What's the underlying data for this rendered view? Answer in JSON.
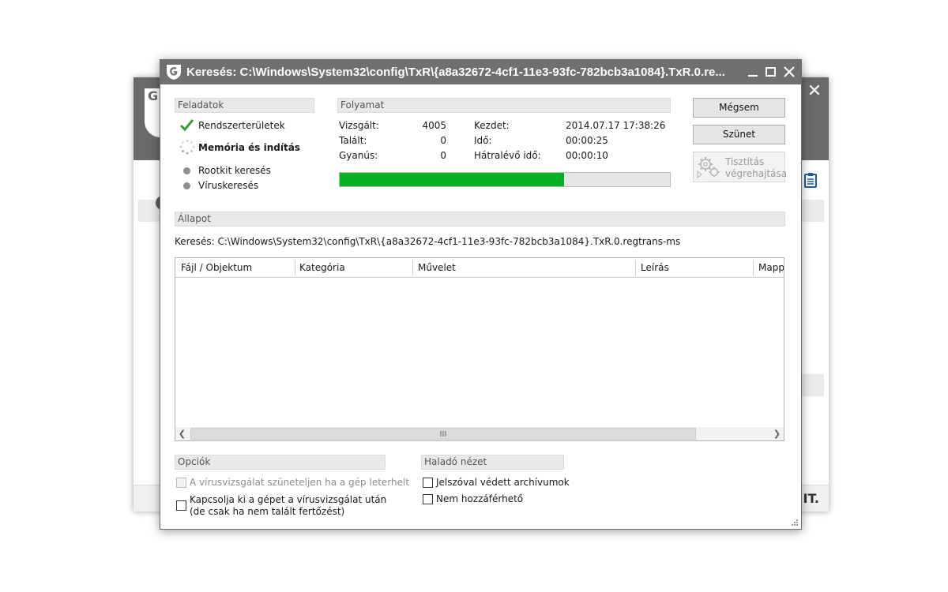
{
  "window": {
    "title": "Keresés: C:\\Windows\\System32\\config\\TxR\\{a8a32672-4cf1-11e3-93fc-782bcb3a1084}.TxR.0.re..."
  },
  "background_window": {
    "logo_text": "G",
    "footer_text": "IT."
  },
  "tasks": {
    "header": "Feladatok",
    "items": [
      {
        "label": "Rendszerterületek",
        "state": "done"
      },
      {
        "label": "Memória és indítás",
        "state": "running"
      },
      {
        "label": "Rootkit keresés",
        "state": "pending"
      },
      {
        "label": "Víruskeresés",
        "state": "pending"
      }
    ]
  },
  "progress": {
    "header": "Folyamat",
    "scanned_label": "Vizsgált:",
    "scanned_value": "4005",
    "found_label": "Talált:",
    "found_value": "0",
    "suspicious_label": "Gyanús:",
    "suspicious_value": "0",
    "start_label": "Kezdet:",
    "start_value": "2014.07.17 17:38:26",
    "time_label": "Idő:",
    "time_value": "00:00:25",
    "remaining_label": "Hátralévő idő:",
    "remaining_value": "00:00:10",
    "bar_fraction": 0.68,
    "bar_color": "#06b025"
  },
  "buttons": {
    "cancel": "Mégsem",
    "pause": "Szünet",
    "clean_line1": "Tisztítás",
    "clean_line2": "végrehajtása"
  },
  "status": {
    "header": "Állapot",
    "text": "Keresés: C:\\Windows\\System32\\config\\TxR\\{a8a32672-4cf1-11e3-93fc-782bcb3a1084}.TxR.0.regtrans-ms"
  },
  "results_table": {
    "columns": [
      "Fájl / Objektum",
      "Kategória",
      "Művelet",
      "Leírás",
      "Mapp"
    ],
    "rows": []
  },
  "options": {
    "header": "Opciók",
    "pause_on_load": "A vírusvizsgálat szüneteljen ha a gép leterhelt",
    "shutdown_line1": "Kapcsolja ki a gépet a vírusvizsgálat után",
    "shutdown_line2": "(de csak ha nem talált fertőzést)"
  },
  "advanced": {
    "header": "Haladó nézet",
    "password_archives": "Jelszóval védett archívumok",
    "inaccessible": "Nem hozzáférhető"
  }
}
